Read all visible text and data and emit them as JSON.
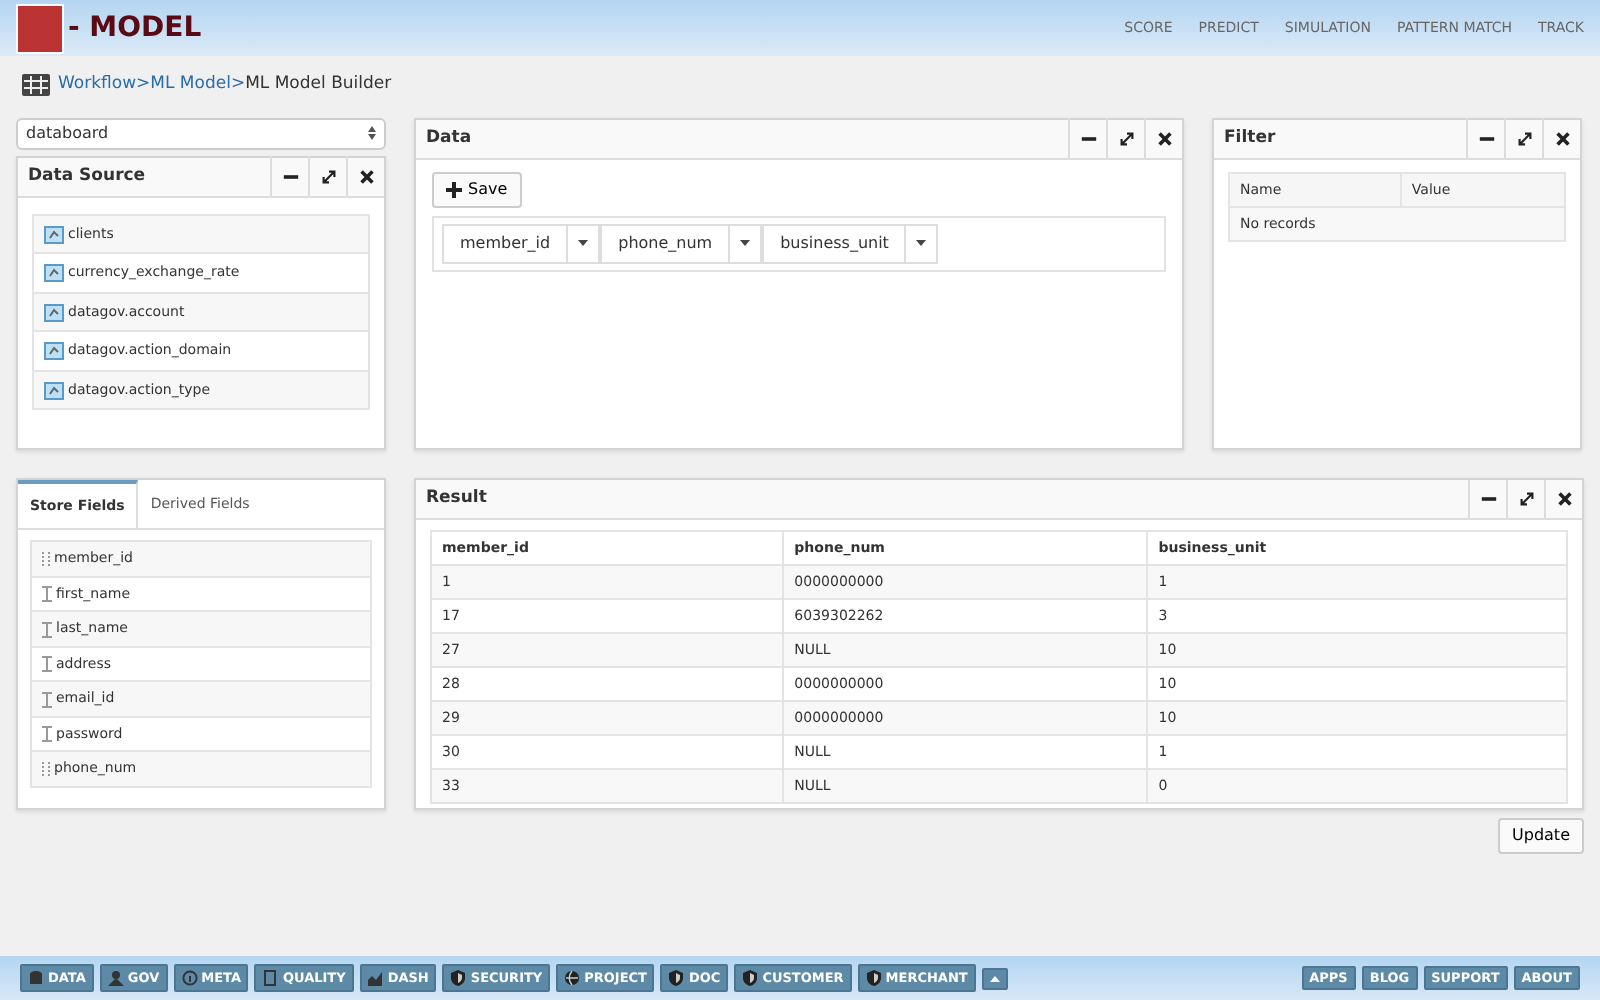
{
  "header": {
    "title": "- MODEL",
    "nav": [
      "SCORE",
      "PREDICT",
      "SIMULATION",
      "PATTERN MATCH",
      "TRACK"
    ]
  },
  "breadcrumb": [
    {
      "label": "Workflow>",
      "link": true
    },
    {
      "label": "ML Model>",
      "link": true
    },
    {
      "label": "ML Model Builder",
      "link": false
    }
  ],
  "source_select": {
    "value": "databoard"
  },
  "data_source": {
    "title": "Data Source",
    "items": [
      "clients",
      "currency_exchange_rate",
      "datagov.account",
      "datagov.action_domain",
      "datagov.action_type"
    ]
  },
  "data": {
    "title": "Data",
    "save_button": "Save",
    "columns": [
      "member_id",
      "phone_num",
      "business_unit"
    ]
  },
  "filter": {
    "title": "Filter",
    "columns": [
      "Name",
      "Value"
    ],
    "empty_text": "No records"
  },
  "fields": {
    "tabs": [
      {
        "label": "Store Fields",
        "selected": true
      },
      {
        "label": "Derived Fields",
        "selected": false
      }
    ],
    "items": [
      {
        "name": "member_id",
        "kind": "number"
      },
      {
        "name": "first_name",
        "kind": "text"
      },
      {
        "name": "last_name",
        "kind": "text"
      },
      {
        "name": "address",
        "kind": "text"
      },
      {
        "name": "email_id",
        "kind": "text"
      },
      {
        "name": "password",
        "kind": "text"
      },
      {
        "name": "phone_num",
        "kind": "number"
      }
    ]
  },
  "result": {
    "title": "Result",
    "columns": [
      "member_id",
      "phone_num",
      "business_unit"
    ],
    "rows": [
      [
        "1",
        "0000000000",
        "1"
      ],
      [
        "17",
        "6039302262",
        "3"
      ],
      [
        "27",
        "NULL",
        "10"
      ],
      [
        "28",
        "0000000000",
        "10"
      ],
      [
        "29",
        "0000000000",
        "10"
      ],
      [
        "30",
        "NULL",
        "1"
      ],
      [
        "33",
        "NULL",
        "0"
      ]
    ]
  },
  "update_button": "Update",
  "bottom_bar": {
    "left": [
      "DATA",
      "GOV",
      "META",
      "QUALITY",
      "DASH",
      "SECURITY",
      "PROJECT",
      "DOC",
      "CUSTOMER",
      "MERCHANT"
    ],
    "right": [
      "APPS",
      "BLOG",
      "SUPPORT",
      "ABOUT"
    ]
  }
}
